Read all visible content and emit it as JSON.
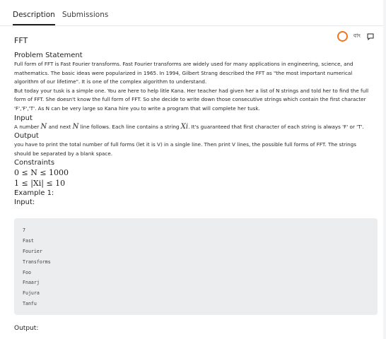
{
  "tabs": [
    "Description",
    "Submissions"
  ],
  "problem": {
    "title": "FFT",
    "lang_label": "বাং",
    "statement_heading": "Problem Statement",
    "statement_p1": "Full form of FFT is Fast Fourier transforms. Fast Fourier transforms are widely used for many applications in engineering, science, and mathematics. The basic ideas were popularized in 1965. In 1994, Gilbert Strang described the FFT as \"the most important numerical algorithm of our lifetime\". It is one of the complex algorithm to understand.",
    "statement_p2": "But today your tusk is a simple one. You are here to help litle Kana. Her teacher had given her a list of N strings and told her to find the full form of FFT. She doesn't know the full form of FFT. So she decide to write down those consecutive strings which contain the first character 'F','F','T'. As N can be very large so Kana hire you to write a program that will complete her tusk.",
    "input_heading": "Input",
    "input_text_a": "A number ",
    "input_var_n": "N",
    "input_text_b": " and next ",
    "input_var_n2": "N",
    "input_text_c": " line follows. Each line contains a string ",
    "input_var_xi": "Xi",
    "input_text_d": ". It's guaranteed that first character of each string is always 'F' or 'T'.",
    "output_heading": "Output",
    "output_text": "you have to print the total number of full forms (let it is V) in a single line. Then print V lines, the possible full forms of FFT. The strings should be separated by a blank space.",
    "constraints_heading": "Constraints",
    "constraint1": "0 ≤ N ≤ 1000",
    "constraint2": "1 ≤ |Xi| ≤ 10",
    "example_heading": "Example 1:",
    "input_label": "Input:",
    "example_input": [
      "7",
      "Fast",
      "Fourier",
      "Transforms",
      "Foo",
      "Fnaarj",
      "Fujura",
      "Tanfu"
    ],
    "output_label": "Output:"
  },
  "colors": {
    "accent_ring": "#f97316",
    "code_bg": "#ecedef"
  },
  "icons": [
    "circle-ring-icon",
    "chat-icon"
  ]
}
